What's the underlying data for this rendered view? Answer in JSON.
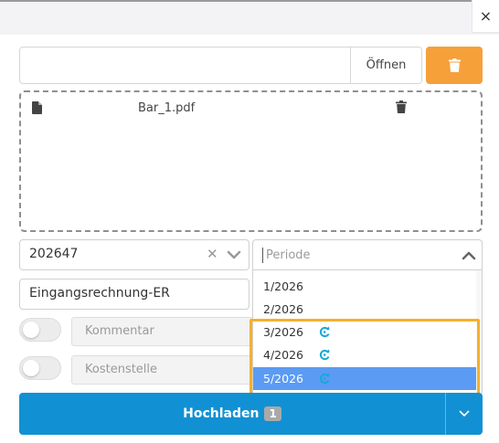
{
  "dialog": {
    "close_label": "×"
  },
  "file_picker": {
    "value": "",
    "open_label": "Öffnen"
  },
  "dropzone": {
    "files": [
      {
        "name": "Bar_1.pdf"
      }
    ]
  },
  "document_select": {
    "value": "202647"
  },
  "period_select": {
    "placeholder": "Periode",
    "options": [
      {
        "label": "1/2026",
        "icon": null,
        "selected": false
      },
      {
        "label": "2/2026",
        "icon": null,
        "selected": false
      },
      {
        "label": "3/2026",
        "icon": "refresh-icon",
        "selected": false
      },
      {
        "label": "4/2026",
        "icon": "refresh-icon",
        "selected": false
      },
      {
        "label": "5/2026",
        "icon": "refresh-icon",
        "selected": true
      }
    ]
  },
  "document_type": {
    "value": "Eingangsrechnung-ER"
  },
  "comment_field": {
    "placeholder": "Kommentar",
    "toggle_on": false
  },
  "cost_center_field": {
    "placeholder": "Kostenstelle",
    "toggle_on": false
  },
  "upload_button": {
    "label": "Hochladen",
    "count": "1"
  },
  "colors": {
    "accent": "#1191d3",
    "delete": "#f6a03a",
    "selected_option": "#5b9bf3",
    "highlight": "#f6b02c",
    "refresh_icon": "#1aa7d8"
  }
}
